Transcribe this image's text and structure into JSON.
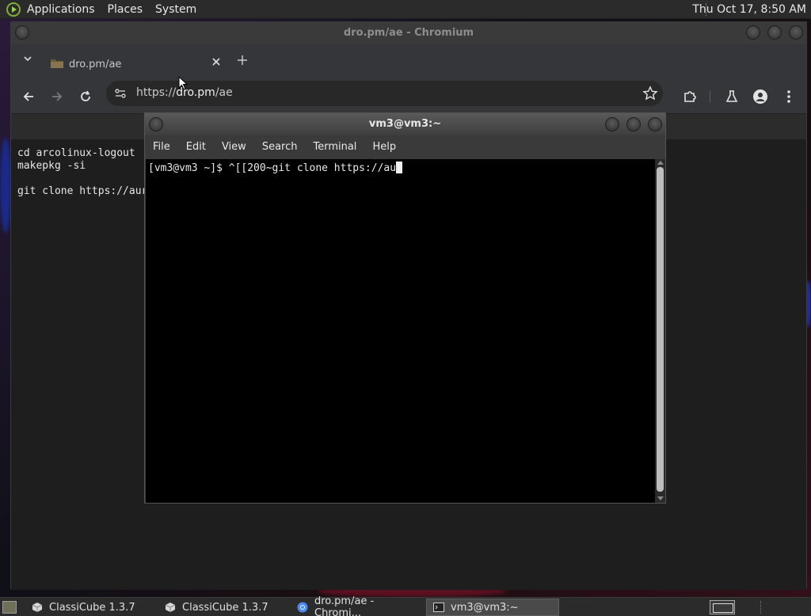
{
  "top_panel": {
    "menus": [
      "Applications",
      "Places",
      "System"
    ],
    "clock": "Thu Oct 17,  8:50 AM"
  },
  "chromium": {
    "window_title": "dro.pm/ae - Chromium",
    "tab": {
      "title": "dro.pm/ae"
    },
    "url": {
      "scheme": "https://",
      "host": "dro.pm",
      "path": "/ae"
    },
    "page_lines": [
      "cd arcolinux-logout",
      "makepkg -si",
      "",
      "git clone https://aur"
    ]
  },
  "terminal": {
    "window_title": "vm3@vm3:~",
    "menu": [
      "File",
      "Edit",
      "View",
      "Search",
      "Terminal",
      "Help"
    ],
    "prompt_line": "[vm3@vm3 ~]$ ^[[200~git clone https://au"
  },
  "taskbar": {
    "tasks": [
      {
        "label": "ClassiCube 1.3.7",
        "icon": "cube-icon"
      },
      {
        "label": "ClassiCube 1.3.7",
        "icon": "cube-icon"
      },
      {
        "label": "dro.pm/ae - Chromi...",
        "icon": "chromium-icon"
      },
      {
        "label": "vm3@vm3:~",
        "icon": "terminal-icon"
      }
    ]
  },
  "colors": {
    "accent_green": "#7fae3a",
    "terminal_bg": "#000000",
    "chromium_toolbar": "#35363a"
  }
}
